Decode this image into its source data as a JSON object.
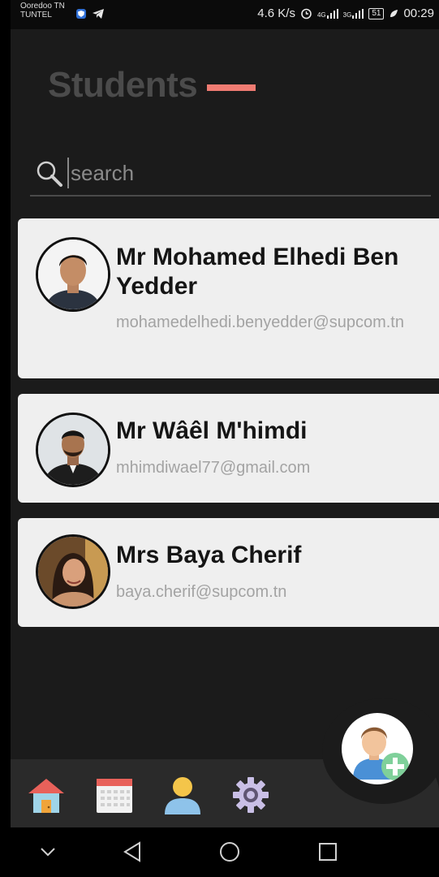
{
  "status_bar": {
    "carrier_line1": "Ooredoo TN",
    "carrier_line2": "TUNTEL",
    "speed": "4.6 K/s",
    "network1": "4G",
    "network2": "3G",
    "battery": "51",
    "time": "00:29"
  },
  "page": {
    "title": "Students"
  },
  "search": {
    "placeholder": "search"
  },
  "students": [
    {
      "name": "Mr Mohamed Elhedi Ben Yedder",
      "email": "mohamedelhedi.benyedder@supcom.tn"
    },
    {
      "name": "Mr Wâêl M'himdi",
      "email": "mhimdiwael77@gmail.com"
    },
    {
      "name": "Mrs Baya Cherif",
      "email": "baya.cherif@supcom.tn"
    }
  ],
  "bottom_nav": {
    "items": [
      {
        "icon": "home-icon"
      },
      {
        "icon": "calendar-icon"
      },
      {
        "icon": "user-icon"
      },
      {
        "icon": "settings-icon"
      }
    ]
  },
  "fab": {
    "icon": "add-user-icon"
  },
  "colors": {
    "background": "#1b1b1b",
    "accent": "#f07b72",
    "card": "#efefef",
    "title": "#4b4b4b"
  }
}
